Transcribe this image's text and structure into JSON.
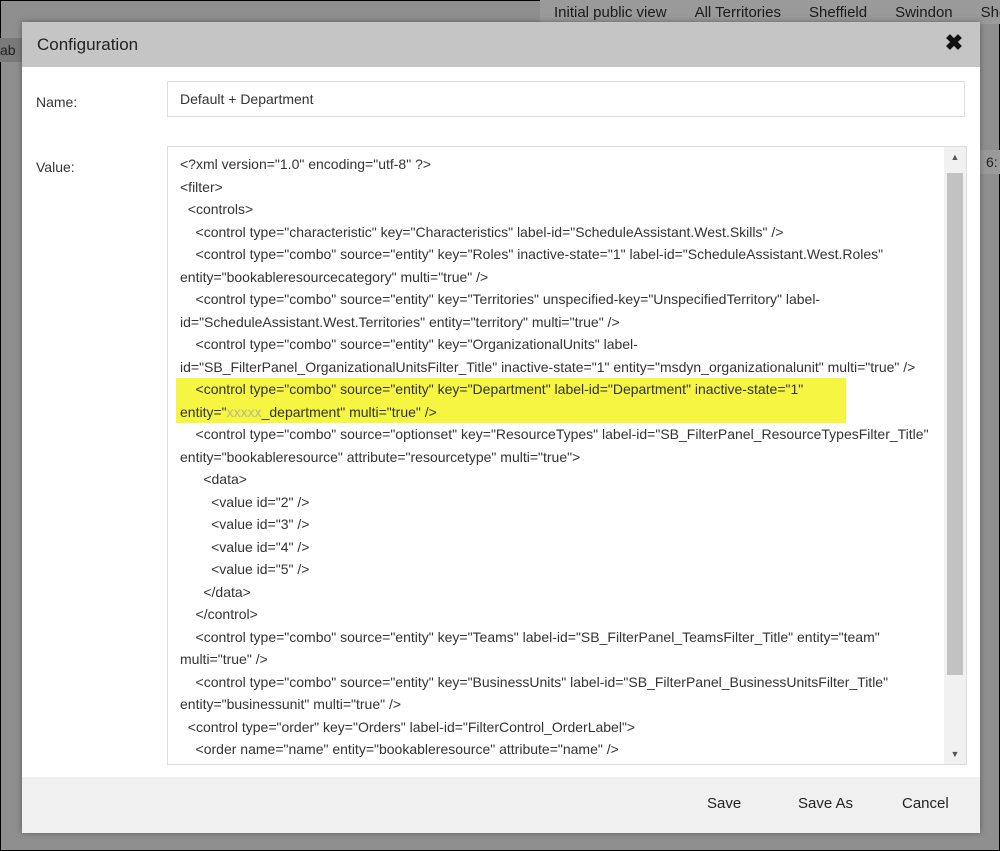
{
  "background": {
    "tabs": [
      "Initial public view",
      "All Territories",
      "Sheffield",
      "Swindon",
      "She"
    ],
    "left_stub": "ab",
    "right_stub": "6:"
  },
  "dialog": {
    "title": "Configuration",
    "close_icon": "close-icon",
    "name_label": "Name:",
    "name_value": "Default + Department",
    "value_label": "Value:",
    "footer": {
      "save": "Save",
      "save_as": "Save As",
      "cancel": "Cancel"
    }
  },
  "xml": {
    "lines": [
      "<?xml version=\"1.0\" encoding=\"utf-8\" ?>",
      "<filter>",
      "  <controls>",
      "    <control type=\"characteristic\" key=\"Characteristics\" label-id=\"ScheduleAssistant.West.Skills\" />",
      "    <control type=\"combo\" source=\"entity\" key=\"Roles\" inactive-state=\"1\" label-id=\"ScheduleAssistant.West.Roles\"",
      "entity=\"bookableresourcecategory\" multi=\"true\" />",
      "    <control type=\"combo\" source=\"entity\" key=\"Territories\" unspecified-key=\"UnspecifiedTerritory\" label-",
      "id=\"ScheduleAssistant.West.Territories\" entity=\"territory\" multi=\"true\" />",
      "    <control type=\"combo\" source=\"entity\" key=\"OrganizationalUnits\" label-",
      "id=\"SB_FilterPanel_OrganizationalUnitsFilter_Title\" inactive-state=\"1\" entity=\"msdyn_organizationalunit\" multi=\"true\" />"
    ],
    "highlight_line_1": "    <control type=\"combo\" source=\"entity\" key=\"Department\" label-id=\"Department\" inactive-state=\"1\"",
    "highlight_line_2_start": "entity=\"",
    "highlight_line_2_blurred": "xxxxx",
    "highlight_line_2_end": "_department\" multi=\"true\" />",
    "lines_after": [
      "    <control type=\"combo\" source=\"optionset\" key=\"ResourceTypes\" label-id=\"SB_FilterPanel_ResourceTypesFilter_Title\"",
      "entity=\"bookableresource\" attribute=\"resourcetype\" multi=\"true\">",
      "      <data>",
      "        <value id=\"2\" />",
      "        <value id=\"3\" />",
      "        <value id=\"4\" />",
      "        <value id=\"5\" />",
      "      </data>",
      "    </control>",
      "    <control type=\"combo\" source=\"entity\" key=\"Teams\" label-id=\"SB_FilterPanel_TeamsFilter_Title\" entity=\"team\"",
      "multi=\"true\" />",
      "    <control type=\"combo\" source=\"entity\" key=\"BusinessUnits\" label-id=\"SB_FilterPanel_BusinessUnitsFilter_Title\"",
      "entity=\"businessunit\" multi=\"true\" />",
      "  <control type=\"order\" key=\"Orders\" label-id=\"FilterControl_OrderLabel\">",
      "    <order name=\"name\" entity=\"bookableresource\" attribute=\"name\" />"
    ]
  },
  "colors": {
    "highlight": "#f5f542",
    "header": "#c5c5c5",
    "footer": "#f0f0f0"
  }
}
